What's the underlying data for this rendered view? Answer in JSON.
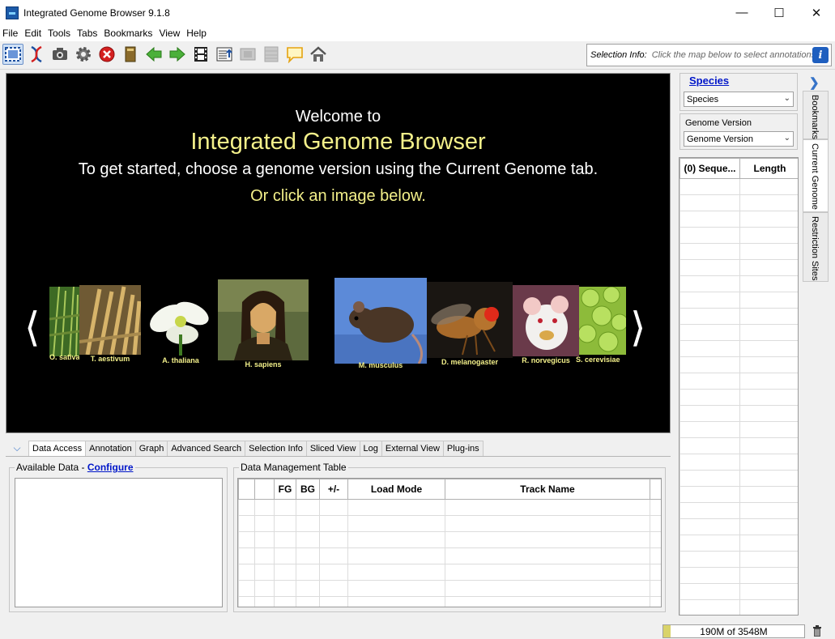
{
  "window": {
    "title": "Integrated Genome Browser 9.1.8"
  },
  "menu": [
    "File",
    "Edit",
    "Tools",
    "Tabs",
    "Bookmarks",
    "View",
    "Help"
  ],
  "toolbar": {
    "buttons": [
      "select-mode-icon",
      "dna-icon",
      "camera-icon",
      "gear-icon",
      "stop-icon",
      "book-icon",
      "back-arrow-icon",
      "forward-arrow-icon",
      "film-icon",
      "upload-panel-icon",
      "disabled-panel-icon",
      "disabled-grid-icon",
      "speech-bubble-icon",
      "home-icon"
    ],
    "selection_info_label": "Selection Info:",
    "selection_info_hint": "Click the map below to select annotations"
  },
  "welcome": {
    "line1": "Welcome to",
    "line2": "Integrated Genome Browser",
    "line3": "To get started, choose a genome version using the Current Genome tab.",
    "line4": "Or click an image below."
  },
  "carousel": [
    {
      "caption": "O. sativa japonica"
    },
    {
      "caption": "T. aestivum"
    },
    {
      "caption": "A. thaliana"
    },
    {
      "caption": "H. sapiens"
    },
    {
      "caption": "M. musculus"
    },
    {
      "caption": "D. melanogaster"
    },
    {
      "caption": "R. norvegicus"
    },
    {
      "caption": "S. cerevisiae"
    }
  ],
  "bottom_tabs": [
    "Data Access",
    "Annotation",
    "Graph",
    "Advanced Search",
    "Selection Info",
    "Sliced View",
    "Log",
    "External View",
    "Plug-ins"
  ],
  "available_data": {
    "label": "Available Data - ",
    "link": "Configure"
  },
  "data_table": {
    "title": "Data Management Table",
    "columns": [
      "",
      "",
      "FG",
      "BG",
      "+/-",
      "Load Mode",
      "Track Name",
      ""
    ]
  },
  "right_panel": {
    "species_link": "Species",
    "species_value": "Species",
    "genome_version_label": "Genome Version",
    "genome_version_value": "Genome Version",
    "seq_columns": [
      "(0) Seque...",
      "Length"
    ]
  },
  "side_tabs": [
    "Bookmarks",
    "Current Genome",
    "Restriction Sites"
  ],
  "status": {
    "memory": "190M of 3548M",
    "memory_fraction": 0.054
  },
  "colors": {
    "accent_yellow": "#f3f08a",
    "link_blue": "#0016c9"
  }
}
